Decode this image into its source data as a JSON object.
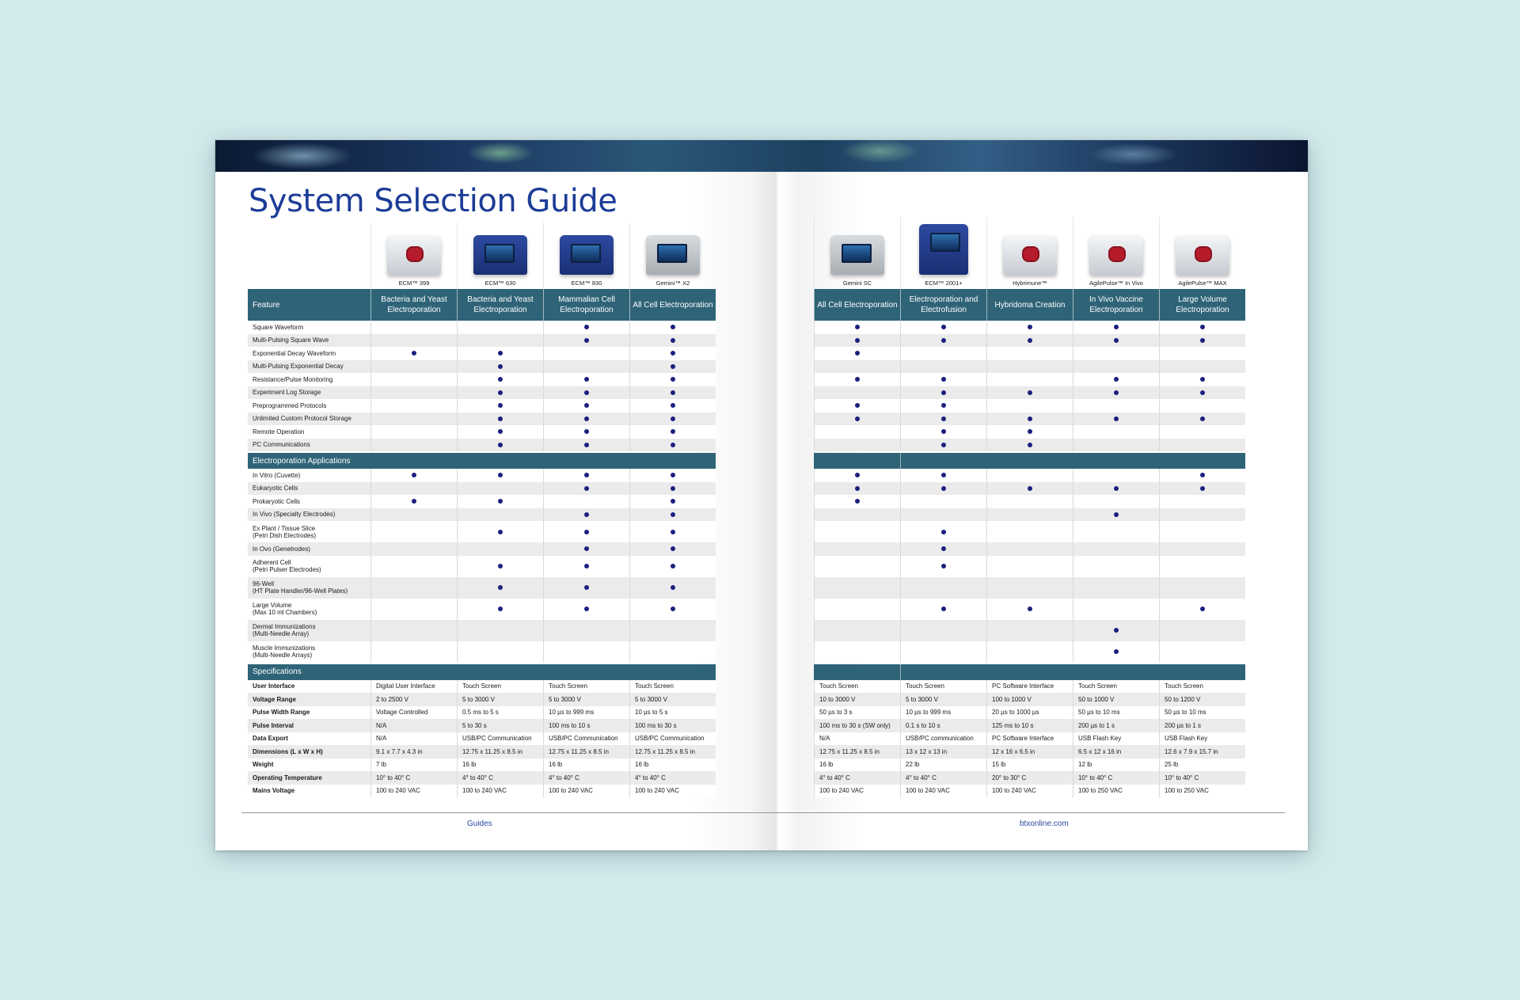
{
  "page": {
    "title": "System Selection Guide",
    "footer_left": "Guides",
    "footer_right": "btxonline.com"
  },
  "left": {
    "feature_header": "Feature",
    "products": [
      {
        "name": "ECM™ 399",
        "header": "Bacteria and Yeast Electroporation"
      },
      {
        "name": "ECM™ 630",
        "header": "Bacteria and Yeast Electroporation"
      },
      {
        "name": "ECM™ 830",
        "header": "Mammalian Cell Electroporation"
      },
      {
        "name": "Gemini™ X2",
        "header": "All Cell Electroporation"
      }
    ],
    "features": [
      {
        "label": "Square Waveform",
        "marks": [
          false,
          false,
          true,
          true
        ]
      },
      {
        "label": "Multi-Pulsing Square Wave",
        "marks": [
          false,
          false,
          true,
          true
        ]
      },
      {
        "label": "Exponential Decay Waveform",
        "marks": [
          true,
          true,
          false,
          true
        ]
      },
      {
        "label": "Multi-Pulsing Exponential Decay",
        "marks": [
          false,
          true,
          false,
          true
        ]
      },
      {
        "label": "Resistance/Pulse Monitoring",
        "marks": [
          false,
          true,
          true,
          true
        ]
      },
      {
        "label": "Experiment Log Storage",
        "marks": [
          false,
          true,
          true,
          true
        ]
      },
      {
        "label": "Preprogrammed Protocols",
        "marks": [
          false,
          true,
          true,
          true
        ]
      },
      {
        "label": "Unlimited Custom Protocol Storage",
        "marks": [
          false,
          true,
          true,
          true
        ]
      },
      {
        "label": "Remote Operation",
        "marks": [
          false,
          true,
          true,
          true
        ]
      },
      {
        "label": "PC Communications",
        "marks": [
          false,
          true,
          true,
          true
        ]
      }
    ],
    "applications_header": "Electroporation Applications",
    "applications": [
      {
        "label": "In Vitro (Cuvette)",
        "sub": "",
        "marks": [
          true,
          true,
          true,
          true
        ]
      },
      {
        "label": "Eukaryotic Cells",
        "sub": "",
        "marks": [
          false,
          false,
          true,
          true
        ]
      },
      {
        "label": "Prokaryotic Cells",
        "sub": "",
        "marks": [
          true,
          true,
          false,
          true
        ]
      },
      {
        "label": "In Vivo (Specialty Electrodes)",
        "sub": "",
        "marks": [
          false,
          false,
          true,
          true
        ]
      },
      {
        "label": "Ex Plant / Tissue Slice",
        "sub": "(Petri Dish Electrodes)",
        "marks": [
          false,
          true,
          true,
          true
        ]
      },
      {
        "label": "In Ovo (Genetrodes)",
        "sub": "",
        "marks": [
          false,
          false,
          true,
          true
        ]
      },
      {
        "label": "Adherent Cell",
        "sub": "(Petri Pulser Electrodes)",
        "marks": [
          false,
          true,
          true,
          true
        ]
      },
      {
        "label": "96-Well",
        "sub": "(HT Plate Handler/96-Well Plates)",
        "marks": [
          false,
          true,
          true,
          true
        ]
      },
      {
        "label": "Large Volume",
        "sub": "(Max 10 ml Chambers)",
        "marks": [
          false,
          true,
          true,
          true
        ]
      },
      {
        "label": "Dermal Immunizations",
        "sub": "(Multi-Needle Array)",
        "marks": [
          false,
          false,
          false,
          false
        ]
      },
      {
        "label": "Muscle Immunizations",
        "sub": "(Multi-Needle Arrays)",
        "marks": [
          false,
          false,
          false,
          false
        ]
      }
    ],
    "specs_header": "Specifications",
    "specs": [
      {
        "label": "User Interface",
        "values": [
          "Digital User Interface",
          "Touch Screen",
          "Touch Screen",
          "Touch Screen"
        ]
      },
      {
        "label": "Voltage Range",
        "values": [
          "2 to 2500 V",
          "5 to 3000 V",
          "5 to 3000 V",
          "5 to 3000 V"
        ]
      },
      {
        "label": "Pulse Width Range",
        "values": [
          "Voltage Controlled",
          "0.5 ms to 5 s",
          "10 µs to 999 ms",
          "10 µs to 5 s"
        ]
      },
      {
        "label": "Pulse Interval",
        "values": [
          "N/A",
          "5 to 30 s",
          "100 ms to 10 s",
          "100 ms to 30 s"
        ]
      },
      {
        "label": "Data Export",
        "values": [
          "N/A",
          "USB/PC Communication",
          "USB/PC Communication",
          "USB/PC Communication"
        ]
      },
      {
        "label": "Dimensions (L x W x H)",
        "values": [
          "9.1 x 7.7 x 4.3 in",
          "12.75 x 11.25 x 8.5 in",
          "12.75 x 11.25 x 8.5 in",
          "12.75 x 11.25 x 8.5 in"
        ]
      },
      {
        "label": "Weight",
        "values": [
          "7 lb",
          "16 lb",
          "16 lb",
          "16 lb"
        ]
      },
      {
        "label": "Operating Temperature",
        "values": [
          "10° to 40° C",
          "4° to 40° C",
          "4° to 40° C",
          "4° to 40° C"
        ]
      },
      {
        "label": "Mains Voltage",
        "values": [
          "100 to 240 VAC",
          "100 to 240 VAC",
          "100 to 240 VAC",
          "100 to 240 VAC"
        ]
      }
    ]
  },
  "right": {
    "products": [
      {
        "name": "Gemini SC",
        "header": "All Cell Electroporation"
      },
      {
        "name": "ECM™ 2001+",
        "header": "Electroporation and Electrofusion"
      },
      {
        "name": "Hybrimune™",
        "header": "Hybridoma Creation"
      },
      {
        "name": "AgilePulse™ In Vivo",
        "header": "In Vivo Vaccine Electroporation"
      },
      {
        "name": "AgilePulse™ MAX",
        "header": "Large Volume Electroporation"
      }
    ],
    "features": [
      [
        true,
        true,
        true,
        true,
        true
      ],
      [
        true,
        true,
        true,
        true,
        true
      ],
      [
        true,
        false,
        false,
        false,
        false
      ],
      [
        false,
        false,
        false,
        false,
        false
      ],
      [
        true,
        true,
        false,
        true,
        true
      ],
      [
        false,
        true,
        true,
        true,
        true
      ],
      [
        true,
        true,
        false,
        false,
        false
      ],
      [
        true,
        true,
        true,
        true,
        true
      ],
      [
        false,
        true,
        true,
        false,
        false
      ],
      [
        false,
        true,
        true,
        false,
        false
      ]
    ],
    "applications": [
      [
        true,
        true,
        false,
        false,
        true
      ],
      [
        true,
        true,
        true,
        true,
        true
      ],
      [
        true,
        false,
        false,
        false,
        false
      ],
      [
        false,
        false,
        false,
        true,
        false
      ],
      [
        false,
        true,
        false,
        false,
        false
      ],
      [
        false,
        true,
        false,
        false,
        false
      ],
      [
        false,
        true,
        false,
        false,
        false
      ],
      [
        false,
        false,
        false,
        false,
        false
      ],
      [
        false,
        true,
        true,
        false,
        true
      ],
      [
        false,
        false,
        false,
        true,
        false
      ],
      [
        false,
        false,
        false,
        true,
        false
      ]
    ],
    "specs": [
      [
        "Touch Screen",
        "Touch Screen",
        "PC Software Interface",
        "Touch Screen",
        "Touch Screen"
      ],
      [
        "10 to 3000 V",
        "5 to 3000 V",
        "100 to 1000 V",
        "50 to 1000 V",
        "50 to 1200 V"
      ],
      [
        "50 µs to 3 s",
        "10 µs to 999 ms",
        "20 µs to 1000 µs",
        "50 µs to 10 ms",
        "50 µs to 10 ms"
      ],
      [
        "100 ms to 30 s (SW only)",
        "0.1 s to 10 s",
        "125 ms to 10 s",
        "200 µs to 1 s",
        "200 µs to 1 s"
      ],
      [
        "N/A",
        "USB/PC communication",
        "PC Software Interface",
        "USB Flash Key",
        "USB Flash Key"
      ],
      [
        "12.75 x 11.25 x 8.5 in",
        "13 x 12 x 13 in",
        "12 x 16 x 6.5 in",
        "6.5 x 12 x 16 in",
        "12.6 x 7.9 x 15.7 in"
      ],
      [
        "16 lb",
        "22 lb",
        "15 lb",
        "12 lb",
        "25 lb"
      ],
      [
        "4° to 40° C",
        "4° to 40° C",
        "20° to 30° C",
        "10° to 40° C",
        "10° to 40° C"
      ],
      [
        "100 to 240 VAC",
        "100 to 240 VAC",
        "100 to 240 VAC",
        "100 to 250 VAC",
        "100 to 250 VAC"
      ]
    ]
  }
}
